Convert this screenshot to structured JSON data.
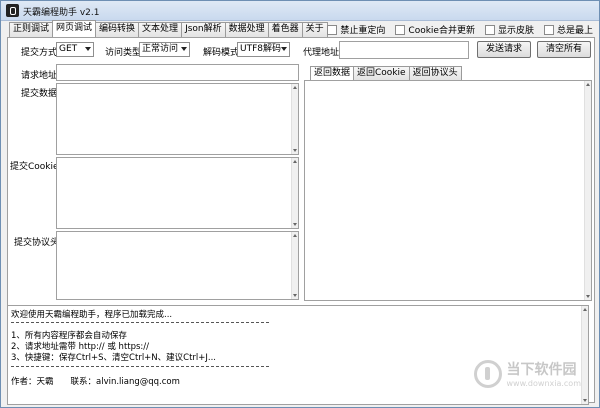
{
  "window": {
    "title": "天霸编程助手 v2.1"
  },
  "tabs": [
    "正则调试",
    "网页调试",
    "编码转换",
    "文本处理",
    "Json解析",
    "数据处理",
    "着色器",
    "关于"
  ],
  "options": [
    {
      "label": "禁止重定向"
    },
    {
      "label": "Cookie合并更新"
    },
    {
      "label": "显示皮肤"
    },
    {
      "label": "总是最上"
    }
  ],
  "request": {
    "method_label": "提交方式",
    "method_value": "GET",
    "access_label": "访问类型",
    "access_value": "正常访问",
    "decode_label": "解码模式",
    "decode_value": "UTF8解码",
    "proxy_label": "代理地址",
    "send_button": "发送请求",
    "clear_button": "清空所有",
    "url_label": "请求地址",
    "data_label": "提交数据",
    "cookie_label": "提交Cookie",
    "header_label": "提交协议头"
  },
  "response_tabs": [
    "返回数据",
    "返回Cookie",
    "返回协议头"
  ],
  "log": {
    "welcome": "欢迎使用天霸编程助手，程序已加载完成...",
    "line1": "1、所有内容程序都会自动保存",
    "line2": "2、请求地址需带 http:// 或 https://",
    "line3": "3、快捷键：保存Ctrl+S、清空Ctrl+N、建议Ctrl+J...",
    "author": "作者：天霸　　联系：alvin.liang@qq.com"
  },
  "watermark": {
    "main": "当下软件园",
    "sub": "www.downxia.com"
  }
}
